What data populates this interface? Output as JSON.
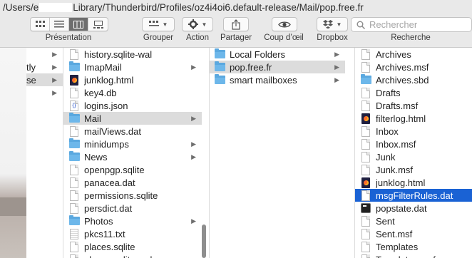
{
  "window": {
    "path_prefix": "/Users/e",
    "path_suffix": "Library/Thunderbird/Profiles/oz4i4oi6.default-release/Mail/pop.free.fr"
  },
  "toolbar": {
    "presentation_label": "Présentation",
    "grouper_label": "Grouper",
    "action_label": "Action",
    "partager_label": "Partager",
    "coup_label": "Coup d’œil",
    "dropbox_label": "Dropbox",
    "recherche_label": "Recherche",
    "search_placeholder": "Rechercher",
    "view_modes": [
      "icon-view",
      "list-view",
      "column-view",
      "gallery-view"
    ],
    "active_view": "column-view"
  },
  "columns": {
    "col0": [
      {
        "label": "",
        "arrow": true
      },
      {
        "label": "tly",
        "arrow": true
      },
      {
        "label": "se",
        "arrow": true,
        "selected": true
      },
      {
        "label": "",
        "arrow": true
      }
    ],
    "col1": [
      {
        "label": "history.sqlite-wal",
        "icon": "doc"
      },
      {
        "label": "ImapMail",
        "icon": "folder",
        "arrow": true
      },
      {
        "label": "junklog.html",
        "icon": "html"
      },
      {
        "label": "key4.db",
        "icon": "doc"
      },
      {
        "label": "logins.json",
        "icon": "json"
      },
      {
        "label": "Mail",
        "icon": "folder",
        "arrow": true,
        "selected": true
      },
      {
        "label": "mailViews.dat",
        "icon": "doc"
      },
      {
        "label": "minidumps",
        "icon": "folder",
        "arrow": true
      },
      {
        "label": "News",
        "icon": "folder",
        "arrow": true
      },
      {
        "label": "openpgp.sqlite",
        "icon": "doc"
      },
      {
        "label": "panacea.dat",
        "icon": "doc"
      },
      {
        "label": "permissions.sqlite",
        "icon": "doc"
      },
      {
        "label": "persdict.dat",
        "icon": "doc"
      },
      {
        "label": "Photos",
        "icon": "folder",
        "arrow": true
      },
      {
        "label": "pkcs11.txt",
        "icon": "text"
      },
      {
        "label": "places.sqlite",
        "icon": "doc"
      },
      {
        "label": "places.sqlite-wal",
        "icon": "doc"
      }
    ],
    "col2": [
      {
        "label": "Local Folders",
        "icon": "folder",
        "arrow": true
      },
      {
        "label": "pop.free.fr",
        "icon": "folder",
        "arrow": true,
        "selected": true
      },
      {
        "label": "smart mailboxes",
        "icon": "folder",
        "arrow": true
      }
    ],
    "col3": [
      {
        "label": "Archives",
        "icon": "doc"
      },
      {
        "label": "Archives.msf",
        "icon": "doc"
      },
      {
        "label": "Archives.sbd",
        "icon": "folder"
      },
      {
        "label": "Drafts",
        "icon": "doc"
      },
      {
        "label": "Drafts.msf",
        "icon": "doc"
      },
      {
        "label": "filterlog.html",
        "icon": "html"
      },
      {
        "label": "Inbox",
        "icon": "doc"
      },
      {
        "label": "Inbox.msf",
        "icon": "doc"
      },
      {
        "label": "Junk",
        "icon": "doc"
      },
      {
        "label": "Junk.msf",
        "icon": "doc"
      },
      {
        "label": "junklog.html",
        "icon": "html"
      },
      {
        "label": "msgFilterRules.dat",
        "icon": "doc",
        "active": true
      },
      {
        "label": "popstate.dat",
        "icon": "term"
      },
      {
        "label": "Sent",
        "icon": "doc"
      },
      {
        "label": "Sent.msf",
        "icon": "doc"
      },
      {
        "label": "Templates",
        "icon": "doc"
      },
      {
        "label": "Templates.msf",
        "icon": "doc"
      }
    ]
  },
  "colors": {
    "selection_active": "#1a62d4",
    "selection_inactive": "#dcdcdc",
    "folder": "#6db7ea"
  }
}
